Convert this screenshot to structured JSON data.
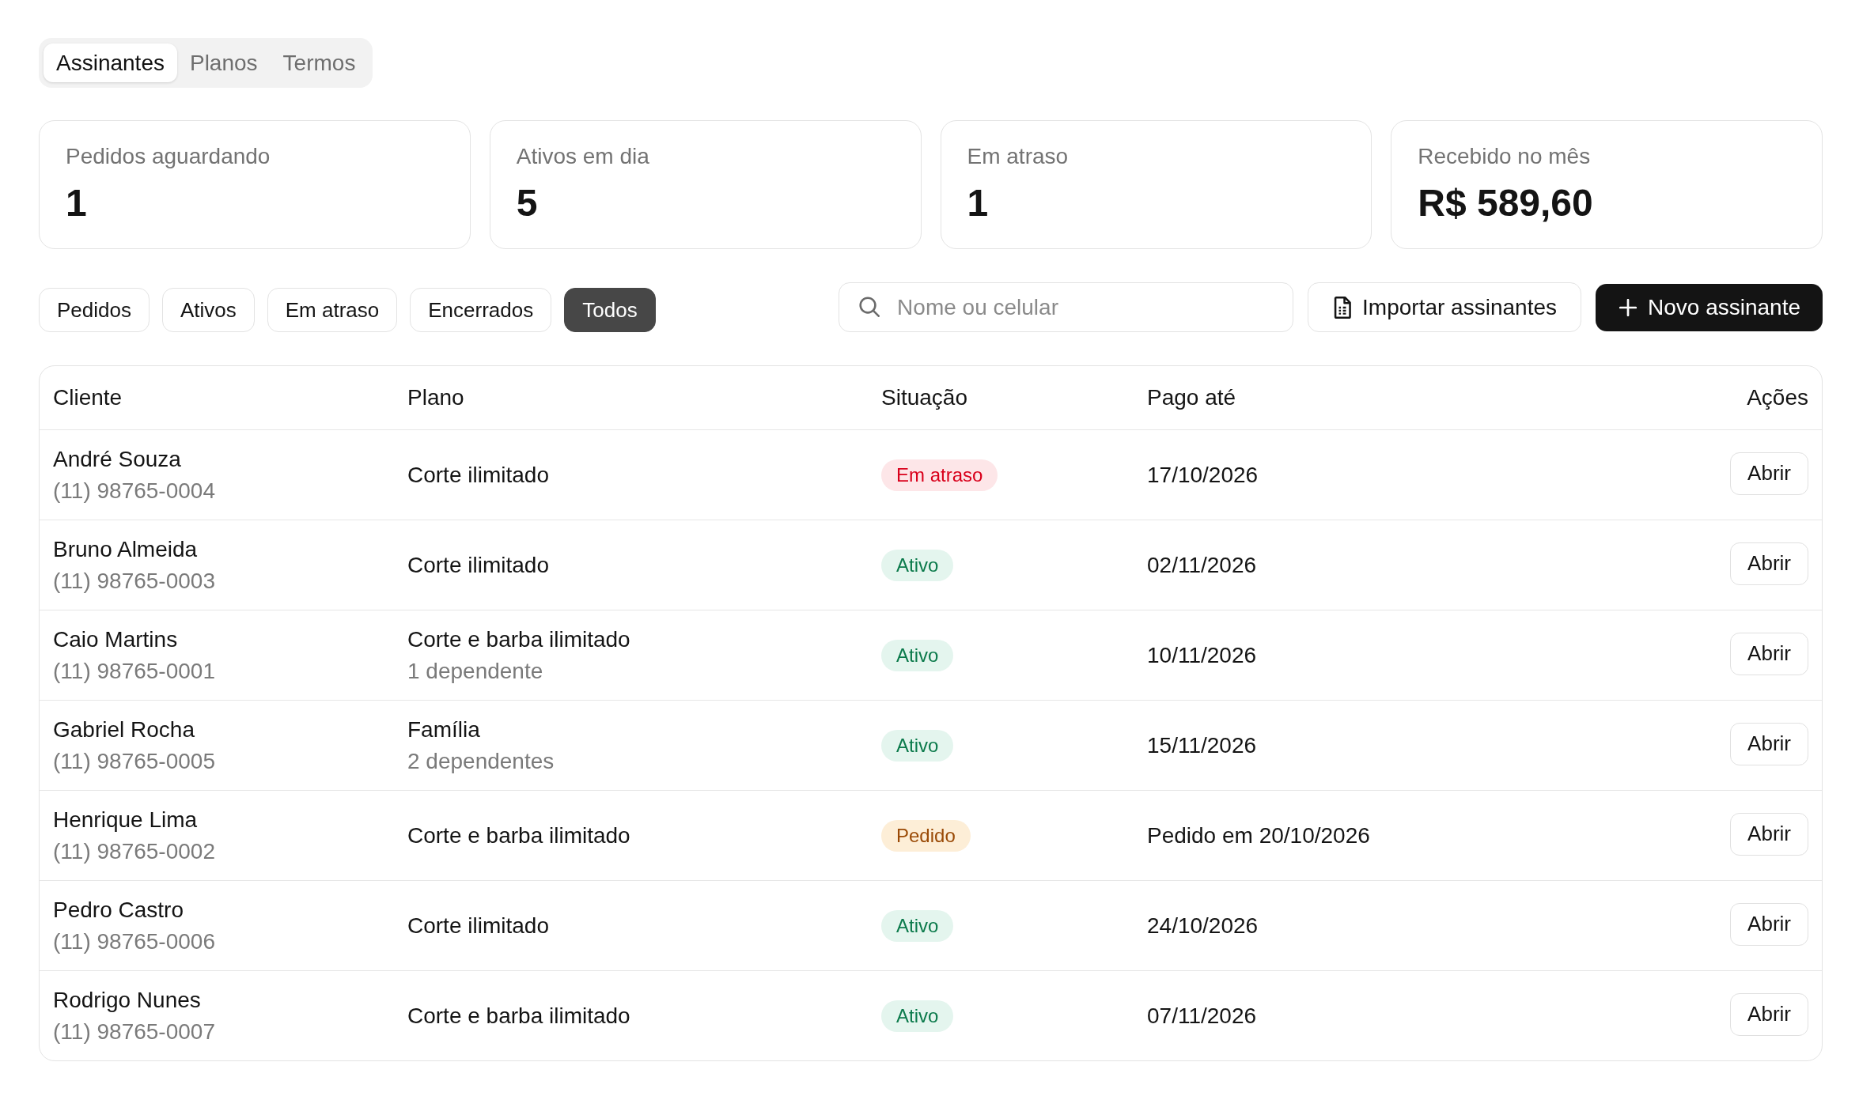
{
  "tabs": [
    {
      "label": "Assinantes",
      "selected": true
    },
    {
      "label": "Planos",
      "selected": false
    },
    {
      "label": "Termos",
      "selected": false
    }
  ],
  "summary_cards": [
    {
      "label": "Pedidos aguardando",
      "value": "1"
    },
    {
      "label": "Ativos em dia",
      "value": "5"
    },
    {
      "label": "Em atraso",
      "value": "1"
    },
    {
      "label": "Recebido no mês",
      "value": "R$ 589,60"
    }
  ],
  "filters": [
    {
      "label": "Pedidos",
      "selected": false
    },
    {
      "label": "Ativos",
      "selected": false
    },
    {
      "label": "Em atraso",
      "selected": false
    },
    {
      "label": "Encerrados",
      "selected": false
    },
    {
      "label": "Todos",
      "selected": true
    }
  ],
  "search": {
    "placeholder": "Nome ou celular"
  },
  "actions": [
    {
      "kind": "import",
      "label": "Importar assinantes"
    },
    {
      "kind": "add",
      "label": "Novo assinante"
    }
  ],
  "table": {
    "columns": [
      "Cliente",
      "Plano",
      "Situação",
      "Pago até",
      "Ações"
    ],
    "rows": [
      {
        "client": "André Souza",
        "phone": "(11) 98765-0004",
        "plan": "Corte ilimitado",
        "status": {
          "label": "Em atraso",
          "kind": "overdue"
        },
        "paid_until": "17/10/2026",
        "action": "Abrir"
      },
      {
        "client": "Bruno Almeida",
        "phone": "(11) 98765-0003",
        "plan": "Corte ilimitado",
        "status": {
          "label": "Ativo",
          "kind": "active"
        },
        "paid_until": "02/11/2026",
        "action": "Abrir"
      },
      {
        "client": "Caio Martins",
        "phone": "(11) 98765-0001",
        "plan": "Corte e barba ilimitado",
        "plan_detail": "1 dependente",
        "status": {
          "label": "Ativo",
          "kind": "active"
        },
        "paid_until": "10/11/2026",
        "action": "Abrir"
      },
      {
        "client": "Gabriel Rocha",
        "phone": "(11) 98765-0005",
        "plan": "Família",
        "plan_detail": "2 dependentes",
        "status": {
          "label": "Ativo",
          "kind": "active"
        },
        "paid_until": "15/11/2026",
        "action": "Abrir"
      },
      {
        "client": "Henrique Lima",
        "phone": "(11) 98765-0002",
        "plan": "Corte e barba ilimitado",
        "status": {
          "label": "Pedido",
          "kind": "requested"
        },
        "paid_until": "Pedido em 20/10/2026",
        "action": "Abrir"
      },
      {
        "client": "Pedro Castro",
        "phone": "(11) 98765-0006",
        "plan": "Corte ilimitado",
        "status": {
          "label": "Ativo",
          "kind": "active"
        },
        "paid_until": "24/10/2026",
        "action": "Abrir"
      },
      {
        "client": "Rodrigo Nunes",
        "phone": "(11) 98765-0007",
        "plan": "Corte e barba ilimitado",
        "status": {
          "label": "Ativo",
          "kind": "active"
        },
        "paid_until": "07/11/2026",
        "action": "Abrir"
      }
    ]
  }
}
